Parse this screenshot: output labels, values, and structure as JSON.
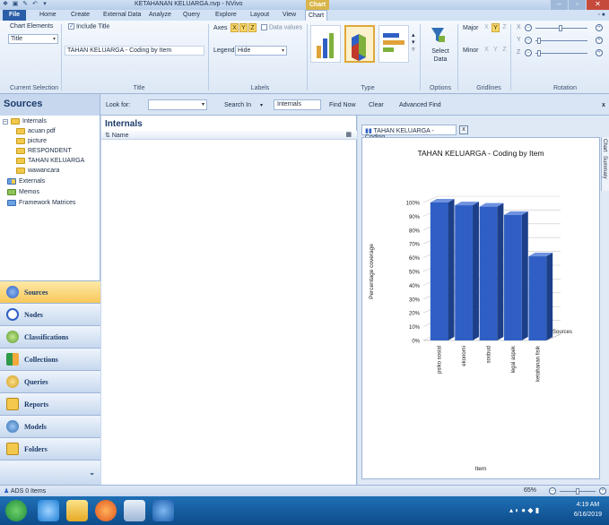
{
  "window": {
    "title": "KETAHANAN KELUARGA.nvp - NVivo",
    "context_tab": "Chart"
  },
  "tabs": [
    "File",
    "Home",
    "Create",
    "External Data",
    "Analyze",
    "Query",
    "Explore",
    "Layout",
    "View",
    "Chart"
  ],
  "ribbon": {
    "chart_elements": {
      "label": "Chart Elements",
      "selected": "Title",
      "group_label": "Current Selection"
    },
    "title": {
      "include_label": "Include Title",
      "include_checked": true,
      "value": "TAHAN KELUARGA - Coding by Item",
      "group_label": "Title"
    },
    "labels": {
      "axes_label": "Axes",
      "axes": [
        "X",
        "Y",
        "Z"
      ],
      "data_values_label": "Data values",
      "legend_label": "Legend",
      "legend_value": "Hide",
      "group_label": "Labels"
    },
    "type_group_label": "Type",
    "options": {
      "select_data_label": "Select Data",
      "group_label": "Options"
    },
    "gridlines": {
      "major_label": "Major",
      "minor_label": "Minor",
      "axes": [
        "X",
        "Y",
        "Z"
      ],
      "group_label": "Gridlines"
    },
    "rotation": {
      "axes": [
        "X",
        "Y",
        "Z"
      ],
      "group_label": "Rotation"
    }
  },
  "findbar": {
    "look_for_label": "Look for:",
    "search_in_label": "Search In",
    "search_in_value": "Internals",
    "find_now": "Find Now",
    "clear": "Clear",
    "advanced_find": "Advanced Find",
    "close": "x"
  },
  "nav": {
    "header": "Sources",
    "tree": [
      {
        "label": "Internals",
        "level": 0
      },
      {
        "label": "acuan pdf",
        "level": 1
      },
      {
        "label": "picture",
        "level": 1
      },
      {
        "label": "RESPONDENT",
        "level": 1
      },
      {
        "label": "TAHAN KELUARGA",
        "level": 1
      },
      {
        "label": "wawancara",
        "level": 1
      },
      {
        "label": "Externals",
        "level": 0
      },
      {
        "label": "Memos",
        "level": 0
      },
      {
        "label": "Framework Matrices",
        "level": 0
      }
    ],
    "buttons": [
      "Sources",
      "Nodes",
      "Classifications",
      "Collections",
      "Queries",
      "Reports",
      "Models",
      "Folders"
    ]
  },
  "list": {
    "title": "Internals",
    "column_name": "Name"
  },
  "chart_tab": {
    "label": "TAHAN KELUARGA - Coding",
    "close": "x"
  },
  "side_tabs": [
    "Chart",
    "Summary"
  ],
  "chart_data": {
    "type": "bar",
    "title": "TAHAN KELUARGA - Coding by Item",
    "xlabel": "Item",
    "ylabel": "Percentage coverage",
    "ylim": [
      0,
      100
    ],
    "yticks": [
      "0%",
      "10%",
      "20%",
      "30%",
      "40%",
      "50%",
      "60%",
      "70%",
      "80%",
      "90%",
      "100%"
    ],
    "categories": [
      "psiko sosial",
      "ekonomi",
      "sosbud",
      "legal aspek",
      "ketahanan fisik"
    ],
    "series": [
      {
        "name": "Sources",
        "values": [
          100,
          98,
          97,
          91,
          61
        ]
      }
    ],
    "bar_color": "#2f5fc4",
    "grid": true
  },
  "status": {
    "user": "ADS",
    "items": "0 Items",
    "zoom": "65%"
  },
  "taskbar": {
    "time": "4:19 AM",
    "date": "6/16/2019"
  }
}
